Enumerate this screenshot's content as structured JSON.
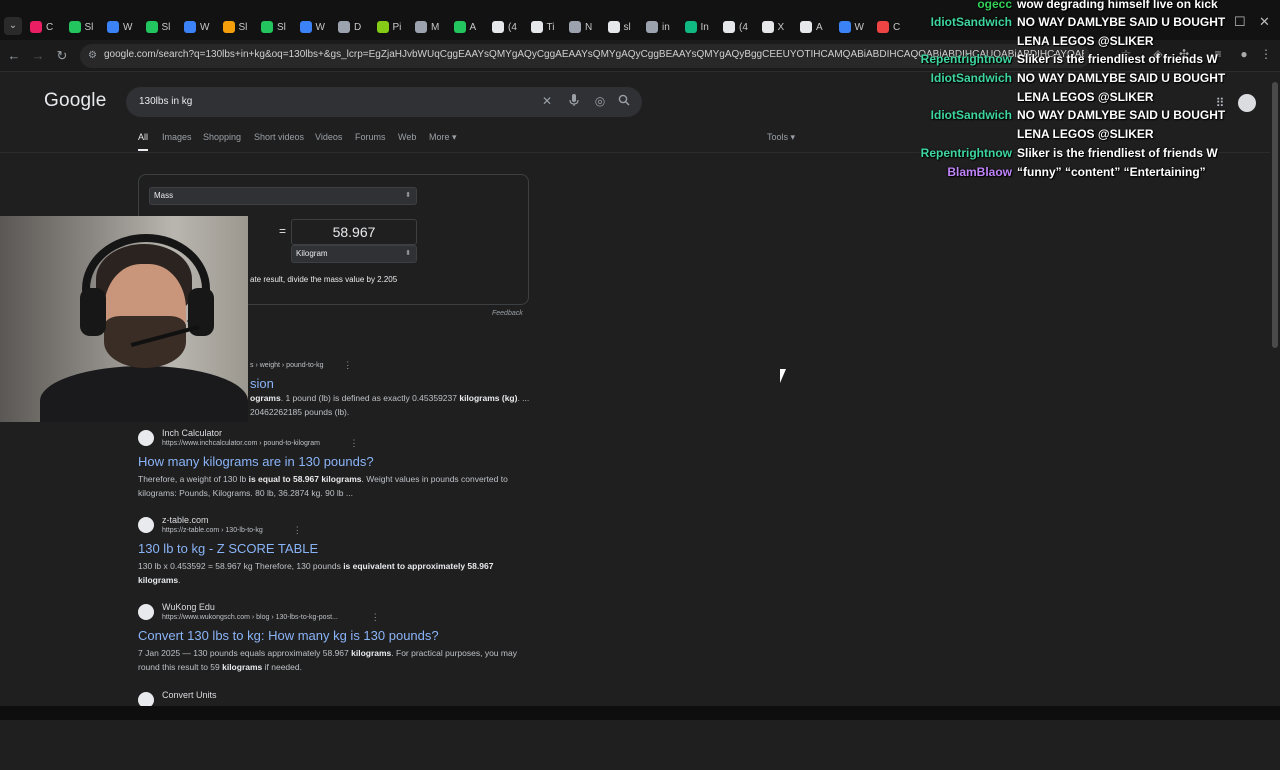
{
  "browser": {
    "tabs": [
      "C",
      "Sl",
      "W",
      "Sl",
      "W",
      "Sl",
      "Sl",
      "W",
      "D",
      "Pi",
      "M",
      "A",
      "(4",
      "Ti",
      "N",
      "sl",
      "in",
      "In",
      "(4",
      "X",
      "A",
      "W",
      "C"
    ],
    "address_url": "google.com/search?q=130lbs+in+kg&oq=130lbs+&gs_lcrp=EgZjaHJvbWUqCggEAAYsQMYgAQyCggAEAAYsQMYgAQyCggBEAAYsQMYgAQyBggCEEUYOTIHCAMQABiABDIHCAQQABiABDIHCAUQABiABDIHCAYQABiABDIHCAcQABiABDIHCAgQABiABDIHCAkQABiABNIBCDcyMTVqMGo3qAIAsAIA&sourceid=chrome&ie=UTF-8",
    "colors": {
      "tabbar": "#121212",
      "omnibox": "#282828"
    }
  },
  "google": {
    "logo": "Google",
    "query": "130lbs in kg",
    "tabs": [
      "All",
      "Images",
      "Shopping",
      "Short videos",
      "Videos",
      "Forums",
      "Web",
      "More"
    ],
    "tools_label": "Tools",
    "converter": {
      "quantity": "Mass",
      "to_value": "58.967",
      "to_unit": "Kilogram",
      "formula_visible": "ate result, divide the mass value by 2.205",
      "equals": "=",
      "feedback": "Feedback"
    },
    "results": [
      {
        "site": "",
        "url": "s › weight › pound-to-kg",
        "title": "sion",
        "snippet_html": "<b>ograms</b>. 1 pound (lb) is defined as exactly 0.45359237 <b>kilograms (kg)</b>. ...<br>20462262185 pounds (lb).",
        "icon": ""
      },
      {
        "site": "Inch Calculator",
        "url": "https://www.inchcalculator.com › pound-to-kilogram",
        "title": "How many kilograms are in 130 pounds?",
        "snippet_html": "Therefore, a weight of 130 lb <b>is equal to 58.967 kilograms</b>. Weight values in pounds converted to kilograms: Pounds, Kilograms. 80 lb, 36.2874 kg. 90 lb ...",
        "icon": "calculator-icon"
      },
      {
        "site": "z-table.com",
        "url": "https://z-table.com › 130-lb-to-kg",
        "title": "130 lb to kg - Z SCORE TABLE",
        "snippet_html": "130 lb x 0.453592 = 58.967 kg Therefore, 130 pounds <b>is equivalent to approximately 58.967 kilograms</b>.",
        "icon": "z-table-icon"
      },
      {
        "site": "WuKong Edu",
        "url": "https://www.wukongsch.com › blog › 130-lbs-to-kg-post...",
        "title": "Convert 130 lbs to kg: How many kg is 130 pounds?",
        "snippet_html": "7 Jan 2025 — 130 pounds equals approximately 58.967 <b>kilograms</b>. For practical purposes, you may round this result to 59 <b>kilograms</b> if needed.",
        "icon": "wukong-icon"
      },
      {
        "site": "Convert Units",
        "url": "",
        "title": "",
        "snippet_html": "",
        "icon": "convert-units-icon"
      }
    ]
  },
  "chat": [
    {
      "user": "ogecc",
      "color": "#34d058",
      "msg": "wow degrading himself live on kick"
    },
    {
      "user": "IdiotSandwich",
      "color": "#3ed6a0",
      "msg": "NO WAY DAMLYBE SAID U BOUGHT LENA LEGOS @SLIKER"
    },
    {
      "user": "Repentrightnow",
      "color": "#3ed6a0",
      "msg": "Sliker is the friendliest of friends W"
    },
    {
      "user": "IdiotSandwich",
      "color": "#3ed6a0",
      "msg": "NO WAY DAMLYBE SAID U BOUGHT LENA LEGOS @SLIKER"
    },
    {
      "user": "IdiotSandwich",
      "color": "#3ed6a0",
      "msg": "NO WAY DAMLYBE SAID U BOUGHT LENA LEGOS @SLIKER"
    },
    {
      "user": "Repentrightnow",
      "color": "#3ed6a0",
      "msg": "Sliker is the friendliest of friends W"
    },
    {
      "user": "BlamBlaow",
      "color": "#c084fc",
      "msg": "“funny” “content” “Entertaining”"
    }
  ]
}
